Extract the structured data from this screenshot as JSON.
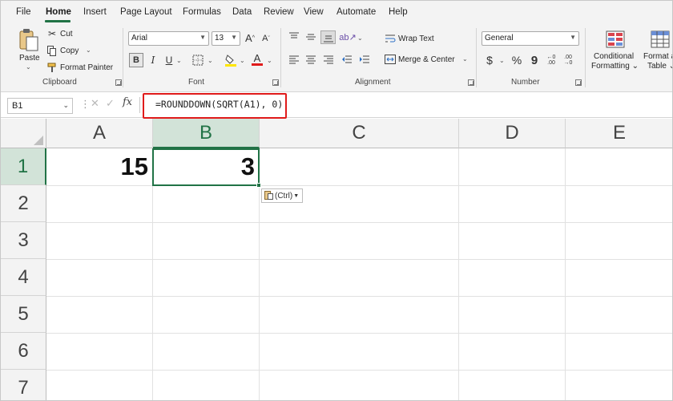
{
  "menu": {
    "tabs": [
      "File",
      "Home",
      "Insert",
      "Page Layout",
      "Formulas",
      "Data",
      "Review",
      "View",
      "Automate",
      "Help"
    ],
    "active_tab": "Home"
  },
  "ribbon": {
    "clipboard": {
      "label": "Clipboard",
      "paste": "Paste",
      "cut": "Cut",
      "copy": "Copy",
      "format_painter": "Format Painter"
    },
    "font": {
      "label": "Font",
      "font_name": "Arial",
      "font_size": "13",
      "bold": "B",
      "italic": "I",
      "underline": "U",
      "grow": "A",
      "shrink": "A",
      "font_color_glyph": "A"
    },
    "alignment": {
      "label": "Alignment",
      "wrap_text": "Wrap Text",
      "merge_center": "Merge & Center"
    },
    "number": {
      "label": "Number",
      "format": "General",
      "currency": "$",
      "percent": "%",
      "comma": "9"
    },
    "styles": {
      "conditional_formatting_line1": "Conditional",
      "conditional_formatting_line2": "Formatting",
      "format_as_table_line1": "Format a",
      "format_as_table_line2": "Table"
    }
  },
  "formula_bar": {
    "name_box": "B1",
    "fx": "fx",
    "formula": "=ROUNDDOWN(SQRT(A1), 0)"
  },
  "sheet": {
    "columns": [
      "A",
      "B",
      "C",
      "D",
      "E"
    ],
    "rows": [
      "1",
      "2",
      "3",
      "4",
      "5",
      "6",
      "7"
    ],
    "selected_cell": "B1",
    "cells": {
      "A1": "15",
      "B1": "3"
    },
    "paste_options": "(Ctrl)"
  },
  "colors": {
    "accent": "#217346",
    "highlight": "#e01b1b",
    "ribbon_bg": "#f3f3f3"
  }
}
